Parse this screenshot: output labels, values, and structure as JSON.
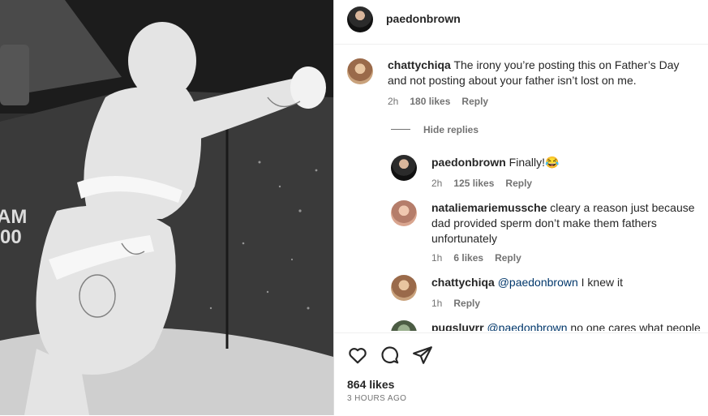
{
  "post": {
    "author": "paedonbrown",
    "likes_text": "864 likes",
    "time_ago": "3 HOURS AGO",
    "photo_truck_text": "AM\n00"
  },
  "comments": [
    {
      "username": "chattychiqa",
      "text": "The irony you’re posting this on Father’s Day and not posting about your father isn’t lost on me.",
      "time": "2h",
      "likes": "180 likes",
      "reply_label": "Reply",
      "hide_replies_label": "Hide replies"
    }
  ],
  "replies": [
    {
      "username": "paedonbrown",
      "text": "Finally!😂",
      "time": "2h",
      "likes": "125 likes",
      "reply_label": "Reply"
    },
    {
      "username": "nataliemariemussche",
      "text_line1": "cleary a reason just because",
      "text_line2": "dad provided sperm don’t make them fathers",
      "text_line3": "unfortunately",
      "time": "1h",
      "likes": "6 likes",
      "reply_label": "Reply"
    },
    {
      "username": "chattychiqa",
      "mention": "@paedonbrown",
      "text": "I knew it",
      "time": "1h",
      "reply_label": "Reply"
    },
    {
      "username": "pugsluvrr",
      "mention": "@paedonbrown",
      "text": "no one cares what people"
    }
  ],
  "icons": [
    "heart-icon",
    "comment-icon",
    "share-icon"
  ]
}
